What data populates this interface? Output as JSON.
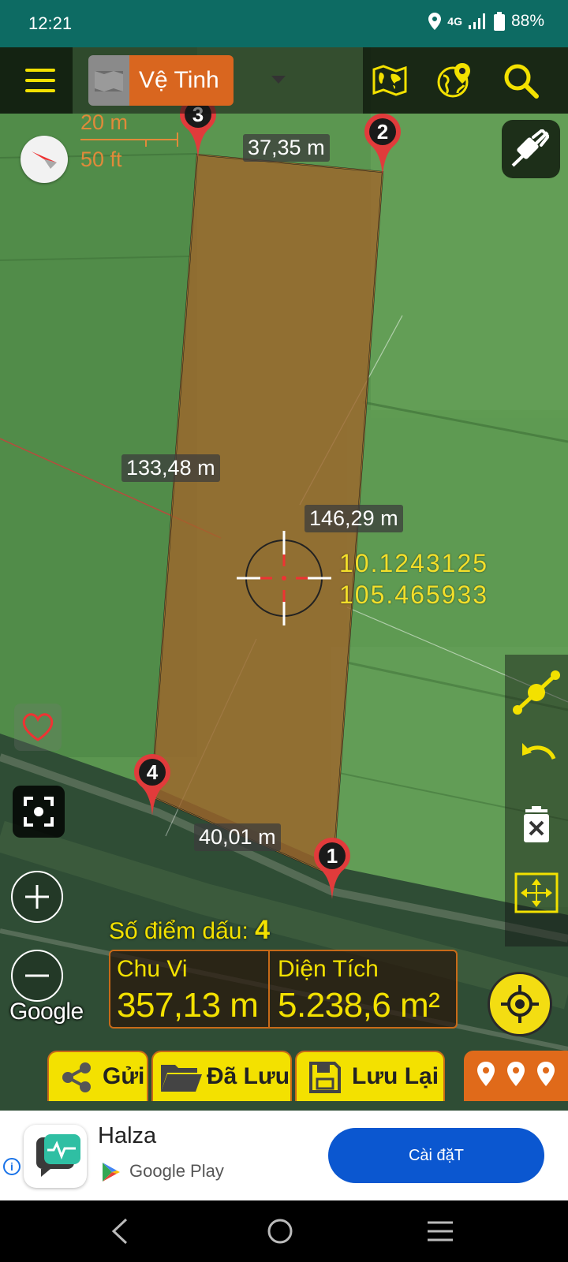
{
  "status_bar": {
    "time": "12:21",
    "network": "4G",
    "battery": "88%"
  },
  "toolbar": {
    "map_type_label": "Vệ Tinh"
  },
  "scale": {
    "metric": "20 m",
    "imperial": "50 ft"
  },
  "map": {
    "markers": [
      "1",
      "2",
      "3",
      "4"
    ],
    "edge_lengths": {
      "top": "37,35 m",
      "left": "133,48 m",
      "right": "146,29 m",
      "bottom": "40,01 m"
    },
    "coordinates": {
      "lat": "10.1243125",
      "lng": "105.465933"
    },
    "attribution": "Google"
  },
  "measurement": {
    "point_count_label": "Số điểm dấu:",
    "point_count": "4",
    "perimeter_label": "Chu Vi",
    "perimeter_value": "357,13 m",
    "area_label": "Diện Tích",
    "area_value": "5.238,6 m²"
  },
  "bottom_buttons": {
    "send": "Gửi",
    "saved": "Đã Lưu",
    "save": "Lưu Lại"
  },
  "ad": {
    "app_name": "Halza",
    "store": "Google Play",
    "install_label": "Cài đặT",
    "info": "i"
  },
  "colors": {
    "accent_yellow": "#f3e100",
    "accent_orange": "#e06a1a",
    "status_teal": "#0d6b63",
    "install_blue": "#0b57d0"
  }
}
